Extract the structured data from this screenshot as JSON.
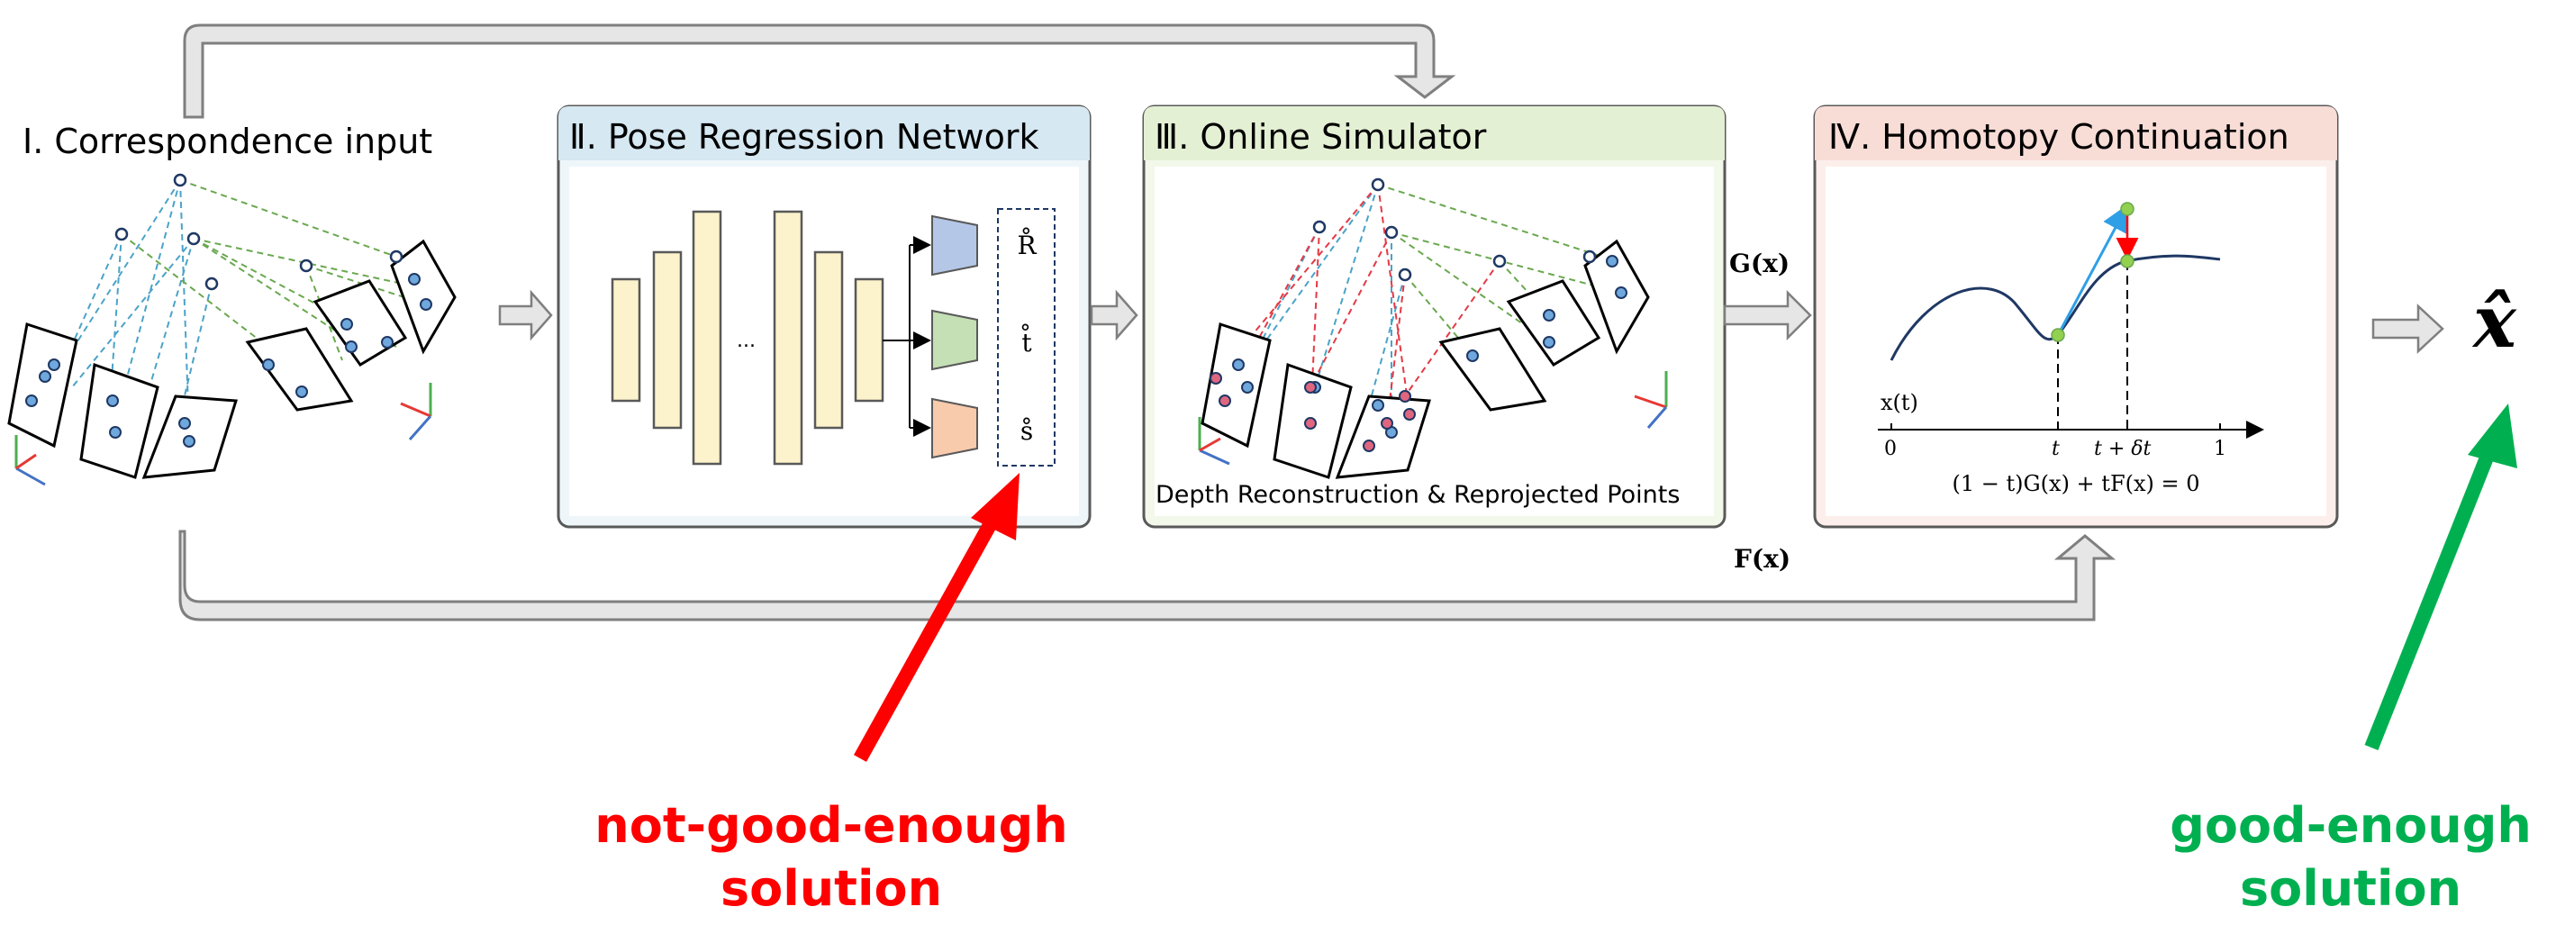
{
  "stages": {
    "s1": {
      "title": "Ⅰ. Correspondence input"
    },
    "s2": {
      "title": "Ⅱ. Pose Regression Network",
      "ellipsis": "...",
      "outputs": [
        "R̊",
        "t̊",
        "s̊"
      ]
    },
    "s3": {
      "title": "Ⅲ. Online Simulator",
      "caption": "Depth Reconstruction & Reprojected Points"
    },
    "s4": {
      "title": "Ⅳ. Homotopy Continuation",
      "curve_label": "x(t)",
      "equation": "(1 − t)G(x) + tF(x) = 0",
      "ticks": [
        "0",
        "t",
        "t + δt",
        "1"
      ]
    }
  },
  "edge_labels": {
    "g": "G(x)",
    "f": "F(x)"
  },
  "result": {
    "symbol": "x̂"
  },
  "annotations": {
    "bad": {
      "lines": [
        "not-good-enough",
        "solution"
      ]
    },
    "good": {
      "lines": [
        "good-enough",
        "solution"
      ]
    }
  },
  "colors": {
    "s2_header": "#d6e8f2",
    "s2_bg": "#eef6fa",
    "s3_header": "#e4f0d4",
    "s3_bg": "#f2f8ea",
    "s4_header": "#f8dcd6",
    "s4_bg": "#fcefeb",
    "block": "#fcf3cc",
    "head_blue": "#b4c7e7",
    "head_green": "#c5e0b4",
    "head_orange": "#f8cbad",
    "red": "#ff0000",
    "green": "#00b050",
    "point": "#6fa8dc",
    "point_red": "#e06680"
  }
}
